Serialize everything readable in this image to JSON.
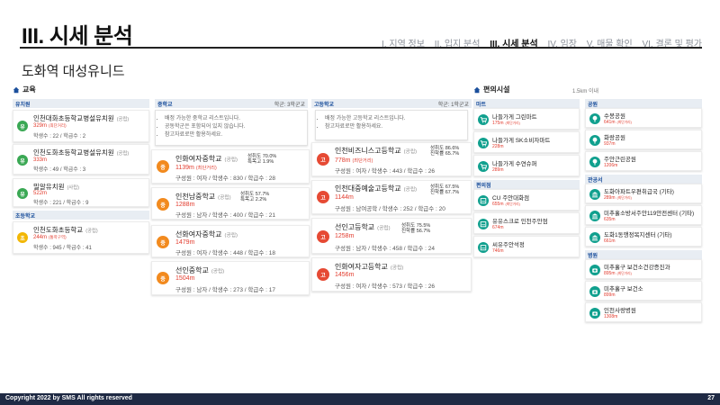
{
  "header": {
    "title": "III. 시세 분석",
    "nav": [
      "I. 지역 정보",
      "II. 입지 분석",
      "III. 시세 분석",
      "IV. 임장",
      "V. 매물 확인",
      "VI. 결론 및 평가"
    ]
  },
  "subtitle": "도화역 대성유니드",
  "education": {
    "title": "교육",
    "kindergarten": {
      "label": "유치원",
      "items": [
        {
          "badge": "유",
          "name": "인천대화초등학교병설유치원",
          "tag": "(공립)",
          "dist": "329m",
          "near": "(최단거리)",
          "meta": "학생수 : 22 / 학급수 : 2"
        },
        {
          "badge": "유",
          "name": "인천도화초등학교병설유치원",
          "tag": "(공립)",
          "dist": "333m",
          "near": "",
          "meta": "학생수 : 49 / 학급수 : 3"
        },
        {
          "badge": "유",
          "name": "밀알유치원",
          "tag": "(사립)",
          "dist": "522m",
          "near": "",
          "meta": "학생수 : 221 / 학급수 : 9"
        }
      ]
    },
    "elementary": {
      "label": "초등학교",
      "items": [
        {
          "badge": "초",
          "name": "인천도화초등학교",
          "tag": "(공립)",
          "dist": "244m",
          "near": "(통학구역)",
          "meta": "학생수 : 945 / 학급수 : 41"
        }
      ]
    },
    "middle": {
      "label": "중학교",
      "right": "학군: 3학군교",
      "notes": [
        "배정 가능한 중학교 리스트입니다.",
        "공동학군은 포함되어 있지 않습니다.",
        "참고자료로만 활용하세요."
      ],
      "items": [
        {
          "badge": "중",
          "name": "인화여자중학교",
          "tag": "(공립)",
          "dist": "1139m",
          "near": "(최단거리)",
          "meta": "구성원 : 여자 / 학생수 : 830 / 학급수 : 28",
          "rate1": "성취도 70.0%",
          "rate2": "특목고 1.9%"
        },
        {
          "badge": "중",
          "name": "인천남중학교",
          "tag": "(공립)",
          "dist": "1288m",
          "near": "",
          "meta": "구성원 : 남자 / 학생수 : 400 / 학급수 : 21",
          "rate1": "성취도 57.7%",
          "rate2": "특목고 2.2%"
        },
        {
          "badge": "중",
          "name": "선화여자중학교",
          "tag": "(공립)",
          "dist": "1479m",
          "near": "",
          "meta": "구성원 : 여자 / 학생수 : 448 / 학급수 : 18",
          "rate1": "",
          "rate2": ""
        },
        {
          "badge": "중",
          "name": "선인중학교",
          "tag": "(공립)",
          "dist": "1504m",
          "near": "",
          "meta": "구성원 : 남자 / 학생수 : 273 / 학급수 : 17",
          "rate1": "",
          "rate2": ""
        }
      ]
    },
    "high": {
      "label": "고등학교",
      "right": "학군: 1학군교",
      "notes": [
        "배정 가능한 고등학교 리스트입니다.",
        "참고자료로만 활용하세요."
      ],
      "items": [
        {
          "badge": "고",
          "name": "인천비즈니스고등학교",
          "tag": "(공립)",
          "dist": "778m",
          "near": "(최단거리)",
          "meta": "구성원 : 여자 / 학생수 : 443 / 학급수 : 26",
          "rate1": "성취도 86.6%",
          "rate2": "진학률 65.7%"
        },
        {
          "badge": "고",
          "name": "인천대중예술고등학교",
          "tag": "(공립)",
          "dist": "1144m",
          "near": "",
          "meta": "구성원 : 남여공학 / 학생수 : 252 / 학급수 : 20",
          "rate1": "성취도 67.5%",
          "rate2": "진학률 67.7%"
        },
        {
          "badge": "고",
          "name": "선인고등학교",
          "tag": "(공립)",
          "dist": "1258m",
          "near": "",
          "meta": "구성원 : 남자 / 학생수 : 458 / 학급수 : 24",
          "rate1": "성취도 75.5%",
          "rate2": "진학률 56.7%"
        },
        {
          "badge": "고",
          "name": "인화여자고등학교",
          "tag": "(공립)",
          "dist": "1456m",
          "near": "",
          "meta": "구성원 : 여자 / 학생수 : 573 / 학급수 : 26",
          "rate1": "",
          "rate2": ""
        }
      ]
    }
  },
  "facilities": {
    "title": "편의시설",
    "note": "1.5km 이내",
    "convenience": {
      "label": "마트",
      "items": [
        {
          "icon": "cart-icon",
          "name": "나들가게 그린마트",
          "dist": "175m",
          "near": "(최단거리)"
        },
        {
          "icon": "cart-icon",
          "name": "나들가게 SK소비자마트",
          "dist": "228m",
          "near": ""
        },
        {
          "icon": "cart-icon",
          "name": "나들가게 수연슈퍼",
          "dist": "289m",
          "near": ""
        }
      ]
    },
    "gas": {
      "label": "편의점",
      "items": [
        {
          "icon": "store-icon",
          "name": "CU 주안대화점",
          "dist": "655m",
          "near": "(최단거리)"
        },
        {
          "icon": "store-icon",
          "name": "유유스크로 인천주안점",
          "dist": "674m",
          "near": ""
        },
        {
          "icon": "store-icon",
          "name": "씨유주안석정",
          "dist": "746m",
          "near": ""
        }
      ]
    },
    "park": {
      "label": "공원",
      "items": [
        {
          "icon": "tree-icon",
          "name": "수봉공원",
          "dist": "641m",
          "near": "(최단거리)"
        },
        {
          "icon": "tree-icon",
          "name": "화랑공원",
          "dist": "937m",
          "near": ""
        },
        {
          "icon": "tree-icon",
          "name": "주안근린공원",
          "dist": "1206m",
          "near": ""
        }
      ]
    },
    "office": {
      "label": "관공서",
      "items": [
        {
          "icon": "building-icon",
          "name": "도화아파트우편취급국 (기타)",
          "dist": "289m",
          "near": "(최단거리)"
        },
        {
          "icon": "building-icon",
          "name": "미추홀소방서주안119안전센터 (기타)",
          "dist": "635m",
          "near": ""
        },
        {
          "icon": "building-icon",
          "name": "도화1동행정복지센터 (기타)",
          "dist": "661m",
          "near": ""
        }
      ]
    },
    "hospital": {
      "label": "병원",
      "items": [
        {
          "icon": "medical-icon",
          "name": "미추홀구 보건소건강증진과",
          "dist": "895m",
          "near": "(최단거리)"
        },
        {
          "icon": "medical-icon",
          "name": "미추홀구 보건소",
          "dist": "899m",
          "near": ""
        },
        {
          "icon": "medical-icon",
          "name": "인천사랑병원",
          "dist": "1308m",
          "near": ""
        }
      ]
    }
  },
  "footer": {
    "copyright": "Copyright 2022 by SMS All rights reserved",
    "page": "27"
  }
}
